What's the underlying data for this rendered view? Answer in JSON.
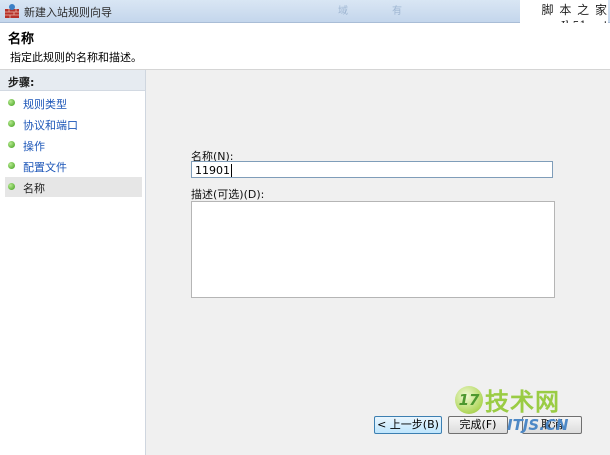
{
  "window": {
    "title": "新建入站规则向导",
    "ghost_labels": [
      "域",
      "有"
    ]
  },
  "watermark_top": {
    "line1": "脚 本 之 家",
    "line2": "www.Jb51.net"
  },
  "header": {
    "title": "名称",
    "description": "指定此规则的名称和描述。"
  },
  "steps": {
    "title": "步骤:",
    "items": [
      {
        "label": "规则类型",
        "active": false
      },
      {
        "label": "协议和端口",
        "active": false
      },
      {
        "label": "操作",
        "active": false
      },
      {
        "label": "配置文件",
        "active": false
      },
      {
        "label": "名称",
        "active": true
      }
    ]
  },
  "form": {
    "name_label": "名称(N):",
    "name_value": "11901",
    "desc_label": "描述(可选)(D):",
    "desc_value": ""
  },
  "buttons": {
    "back": "< 上一步(B)",
    "finish": "完成(F)",
    "cancel": "取消"
  },
  "watermark_bottom": {
    "logo_num": "17",
    "logo_text": "技术网",
    "url": "ITJS.CN"
  },
  "colors": {
    "link": "#1c56b8",
    "step_bullet": "#3e9d1b",
    "content_bg": "#f0f0f0",
    "header_bg": "#ffffff"
  }
}
